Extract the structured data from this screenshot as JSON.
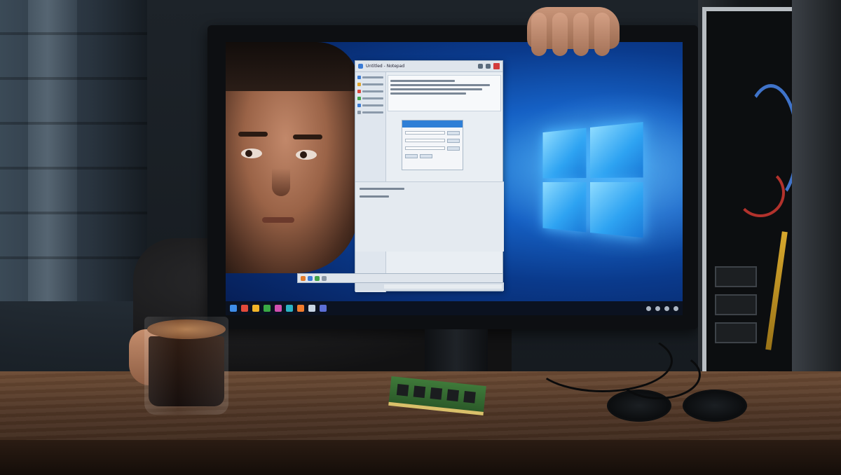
{
  "scene": {
    "description_tags": [
      "person-behind-monitor",
      "windows-desktop",
      "open-pc-case",
      "coffee",
      "ram-module",
      "glasses"
    ]
  },
  "screen": {
    "app": {
      "title": "Untitled - Notepad"
    },
    "taskbar": {
      "apps": [
        "#e24a3b",
        "#3f8de8",
        "#f0b429",
        "#39a845",
        "#d04fb0",
        "#2bb3c4",
        "#f07b2c",
        "#c7d4e2",
        "#5c6fd6"
      ]
    }
  },
  "colors": {
    "wallpaper_accent": "#2ea3f2",
    "taskbar": "#0b1220",
    "ram_pcb": "#3f7a3a",
    "cable_blue": "#3f73c9",
    "cable_red": "#b2322c"
  }
}
